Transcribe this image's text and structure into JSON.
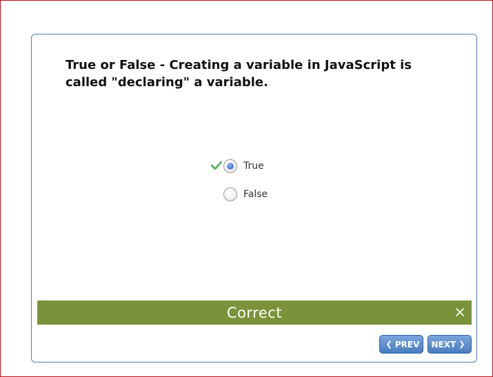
{
  "quiz": {
    "question": "True or False - Creating a variable in JavaScript is called \"declaring\" a variable.",
    "options": [
      {
        "label": "True",
        "selected": true,
        "marked_correct": true
      },
      {
        "label": "False",
        "selected": false,
        "marked_correct": false
      }
    ]
  },
  "feedback": {
    "text": "Correct",
    "color": "#7a9239"
  },
  "navigation": {
    "prev_label": "PREV",
    "next_label": "NEXT",
    "prev_icon": "chevron-left-icon",
    "next_icon": "chevron-right-icon"
  },
  "colors": {
    "accent": "#4a7dc0",
    "frame_border": "#b5121b",
    "card_border": "#4f7fb3",
    "check": "#5cb85c"
  }
}
